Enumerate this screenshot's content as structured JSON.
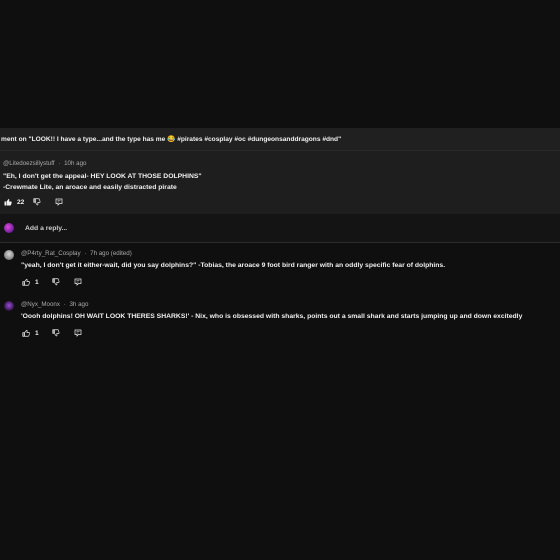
{
  "context": {
    "text": "ment on \"LOOK!! I have a type...and the type has me 😂 #pirates #cosplay #oc #dungeonsanddragons #dnd\""
  },
  "pinned_comment": {
    "author": "@Litedoezsillystuff",
    "time": "10h ago",
    "lines": [
      "\"Eh, I don't get the appeal- HEY LOOK AT THOSE DOLPHINS\"",
      "-Crewmate Lite, an aroace and easily distracted pirate"
    ],
    "likes": "22"
  },
  "reply_box": {
    "placeholder": "Add a reply..."
  },
  "replies": [
    {
      "author": "@P4rty_Rat_Cosplay",
      "time": "7h ago (edited)",
      "text": "\"yeah, I don't get it either-wait, did you say dolphins?\"  -Tobias, the aroace 9 foot bird ranger with an oddly specific fear of dolphins.",
      "likes": "1"
    },
    {
      "author": "@Nyx_Moonx",
      "time": "3h ago",
      "text": "'Oooh dolphins! OH WAIT LOOK THERES SHARKS!' - Nix, who is obsessed with sharks, points out a small shark and starts jumping up and down excitedly",
      "likes": "1"
    }
  ],
  "separator": "·",
  "icons": {
    "like": "thumbs-up-icon",
    "dislike": "thumbs-down-icon",
    "reply": "reply-icon"
  },
  "colors": {
    "background": "#0f0f0f",
    "context_bar": "#202020",
    "pinned_bg": "#1e1e1e",
    "text": "#f1f1f1",
    "secondary_text": "#aaaaaa"
  }
}
